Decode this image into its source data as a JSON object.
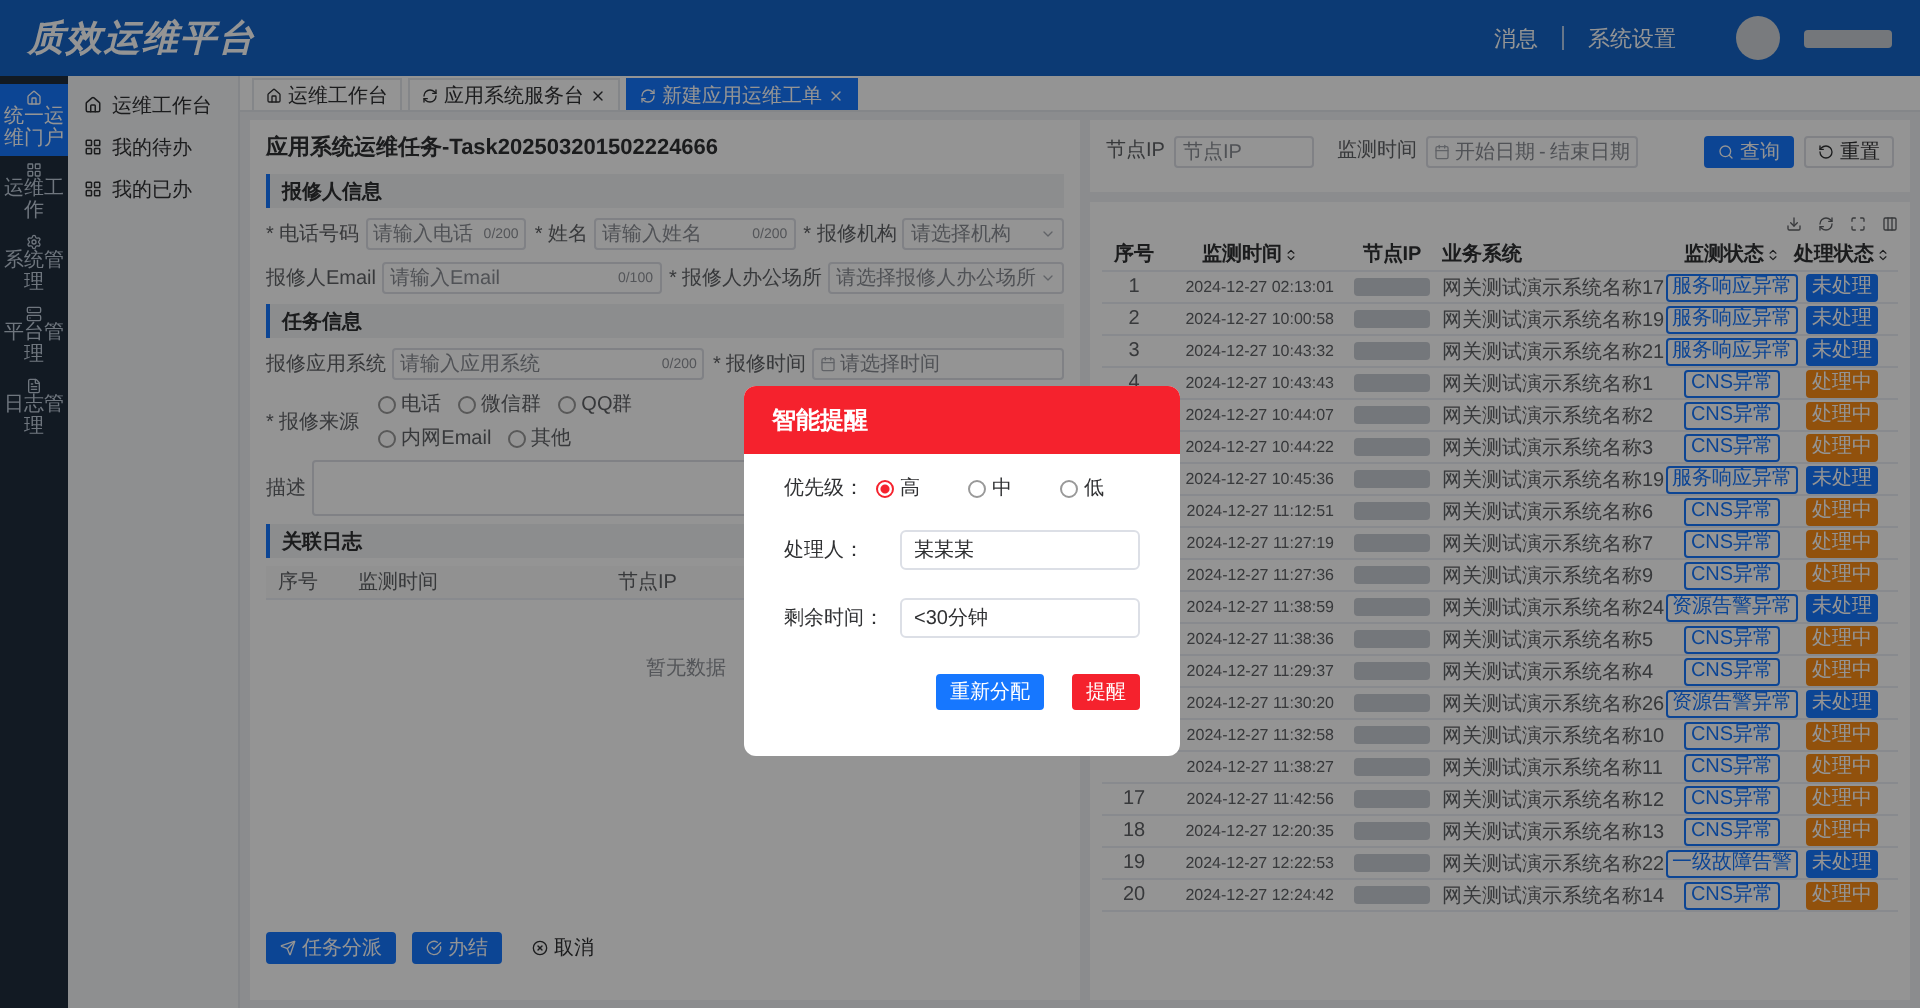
{
  "header": {
    "title": "质效运维平台",
    "links": [
      "消息",
      "系统设置"
    ]
  },
  "nav": [
    {
      "label": "统一运维门户",
      "selected": true
    },
    {
      "label": "运维工作",
      "selected": false
    },
    {
      "label": "系统管理",
      "selected": false
    },
    {
      "label": "平台管理",
      "selected": false
    },
    {
      "label": "日志管理",
      "selected": false
    }
  ],
  "submenu": [
    "运维工作台",
    "我的待办",
    "我的已办"
  ],
  "tabs": [
    {
      "label": "运维工作台",
      "closable": false,
      "selected": false
    },
    {
      "label": "应用系统服务台",
      "closable": true,
      "selected": false
    },
    {
      "label": "新建应用运维工单",
      "closable": true,
      "selected": true
    }
  ],
  "form": {
    "title": "应用系统运维任务-Task202503201502224666",
    "sections": [
      {
        "title": "报修人信息",
        "rows": [
          [
            {
              "kind": "input",
              "label": "* 电话号码",
              "placeholder": "请输入电话",
              "counter": "0/200"
            },
            {
              "kind": "input",
              "label": "* 姓名",
              "placeholder": "请输入姓名",
              "counter": "0/200"
            },
            {
              "kind": "select",
              "label": "* 报修机构",
              "placeholder": "请选择机构"
            }
          ],
          [
            {
              "kind": "input",
              "label": "报修人Email",
              "placeholder": "请输入Email",
              "counter": "0/100"
            },
            {
              "kind": "select",
              "label": "* 报修人办公场所",
              "placeholder": "请选择报修人办公场所"
            }
          ]
        ]
      },
      {
        "title": "任务信息",
        "rows": [
          [
            {
              "kind": "input",
              "label": "报修应用系统",
              "placeholder": "请输入应用系统",
              "counter": "0/200"
            },
            {
              "kind": "date",
              "label": "* 报修时间",
              "placeholder": "请选择时间"
            }
          ],
          [
            {
              "kind": "radio",
              "label": "* 报修来源",
              "options": [
                {
                  "label": "电话",
                  "selected": false
                },
                {
                  "label": "微信群",
                  "selected": false
                },
                {
                  "label": "QQ群",
                  "selected": false
                },
                {
                  "label": "内网Email",
                  "selected": false
                },
                {
                  "label": "其他",
                  "selected": false
                }
              ]
            }
          ],
          [
            {
              "kind": "textarea",
              "label": "描述"
            }
          ]
        ]
      }
    ]
  },
  "log": {
    "title": "关联日志",
    "columns": [
      "序号",
      "监测时间",
      "节点IP"
    ],
    "empty": "暂无数据"
  },
  "actions": [
    {
      "label": "任务分派",
      "kind": "primary"
    },
    {
      "label": "办结",
      "kind": "primary"
    },
    {
      "label": "取消",
      "kind": "text"
    }
  ],
  "filters": {
    "ip": {
      "label": "节点IP",
      "placeholder": "节点IP"
    },
    "time": {
      "label": "监测时间",
      "start": "开始日期",
      "sep": "-",
      "end": "结束日期"
    },
    "buttons": [
      {
        "label": "查询",
        "kind": "primary"
      },
      {
        "label": "重置",
        "kind": "default"
      }
    ]
  },
  "table": {
    "columns": [
      {
        "label": "序号",
        "sortable": false
      },
      {
        "label": "监测时间",
        "sortable": true
      },
      {
        "label": "节点IP",
        "sortable": false
      },
      {
        "label": "业务系统",
        "sortable": false
      },
      {
        "label": "监测状态",
        "sortable": true
      },
      {
        "label": "处理状态",
        "sortable": true
      }
    ],
    "rows": [
      {
        "seq": "1",
        "time": "2024-12-27 02:13:01",
        "system": "网关测试演示系统名称17",
        "status": "服务响应异常",
        "state": "未处理",
        "color": "#0d4594"
      },
      {
        "seq": "2",
        "time": "2024-12-27 10:00:58",
        "system": "网关测试演示系统名称19",
        "status": "服务响应异常",
        "state": "未处理",
        "color": "#0d4594"
      },
      {
        "seq": "3",
        "time": "2024-12-27 10:43:32",
        "system": "网关测试演示系统名称21",
        "status": "服务响应异常",
        "state": "未处理",
        "color": "#0d4594"
      },
      {
        "seq": "4",
        "time": "2024-12-27 10:43:43",
        "system": "网关测试演示系统名称1",
        "status": "CNS异常",
        "state": "处理中",
        "color": "#91510d"
      },
      {
        "time": "2024-12-27 10:44:07",
        "system": "网关测试演示系统名称2",
        "status": "CNS异常",
        "state": "处理中",
        "color": "#91510d"
      },
      {
        "time": "2024-12-27 10:44:22",
        "system": "网关测试演示系统名称3",
        "status": "CNS异常",
        "state": "处理中",
        "color": "#91510d"
      },
      {
        "time": "2024-12-27 10:45:36",
        "system": "网关测试演示系统名称19",
        "status": "服务响应异常",
        "state": "未处理",
        "color": "#0d4594"
      },
      {
        "time": "2024-12-27 11:12:51",
        "system": "网关测试演示系统名称6",
        "status": "CNS异常",
        "state": "处理中",
        "color": "#91510d"
      },
      {
        "time": "2024-12-27 11:27:19",
        "system": "网关测试演示系统名称7",
        "status": "CNS异常",
        "state": "处理中",
        "color": "#91510d"
      },
      {
        "time": "2024-12-27 11:27:36",
        "system": "网关测试演示系统名称9",
        "status": "CNS异常",
        "state": "处理中",
        "color": "#91510d"
      },
      {
        "time": "2024-12-27 11:38:59",
        "system": "网关测试演示系统名称24",
        "status": "资源告警异常",
        "state": "未处理",
        "color": "#0d4594"
      },
      {
        "time": "2024-12-27 11:38:36",
        "system": "网关测试演示系统名称5",
        "status": "CNS异常",
        "state": "处理中",
        "color": "#91510d"
      },
      {
        "time": "2024-12-27 11:29:37",
        "system": "网关测试演示系统名称4",
        "status": "CNS异常",
        "state": "处理中",
        "color": "#91510d"
      },
      {
        "time": "2024-12-27 11:30:20",
        "system": "网关测试演示系统名称26",
        "status": "资源告警异常",
        "state": "未处理",
        "color": "#0d4594"
      },
      {
        "time": "2024-12-27 11:32:58",
        "system": "网关测试演示系统名称10",
        "status": "CNS异常",
        "state": "处理中",
        "color": "#91510d"
      },
      {
        "time": "2024-12-27 11:38:27",
        "system": "网关测试演示系统名称11",
        "status": "CNS异常",
        "state": "处理中",
        "color": "#91510d"
      },
      {
        "seq": "17",
        "time": "2024-12-27 11:42:56",
        "system": "网关测试演示系统名称12",
        "status": "CNS异常",
        "state": "处理中",
        "color": "#91510d"
      },
      {
        "seq": "18",
        "time": "2024-12-27 12:20:35",
        "system": "网关测试演示系统名称13",
        "status": "CNS异常",
        "state": "处理中",
        "color": "#91510d"
      },
      {
        "seq": "19",
        "time": "2024-12-27 12:22:53",
        "system": "网关测试演示系统名称22",
        "status": "一级故障告警",
        "state": "未处理",
        "color": "#0d4594"
      },
      {
        "seq": "20",
        "time": "2024-12-27 12:24:42",
        "system": "网关测试演示系统名称14",
        "status": "CNS异常",
        "state": "处理中",
        "color": "#91510d"
      }
    ]
  },
  "modal": {
    "title": "智能提醒",
    "priority": {
      "label": "优先级：",
      "options": [
        {
          "label": "高",
          "selected": true
        },
        {
          "label": "中",
          "selected": false
        },
        {
          "label": "低",
          "selected": false
        }
      ]
    },
    "assignee": {
      "label": "处理人：",
      "value": "某某某"
    },
    "remaining": {
      "label": "剩余时间：",
      "value": "<30分钟"
    },
    "buttons": [
      {
        "label": "重新分配",
        "kind": "primary"
      },
      {
        "label": "提醒",
        "kind": "danger"
      }
    ]
  }
}
